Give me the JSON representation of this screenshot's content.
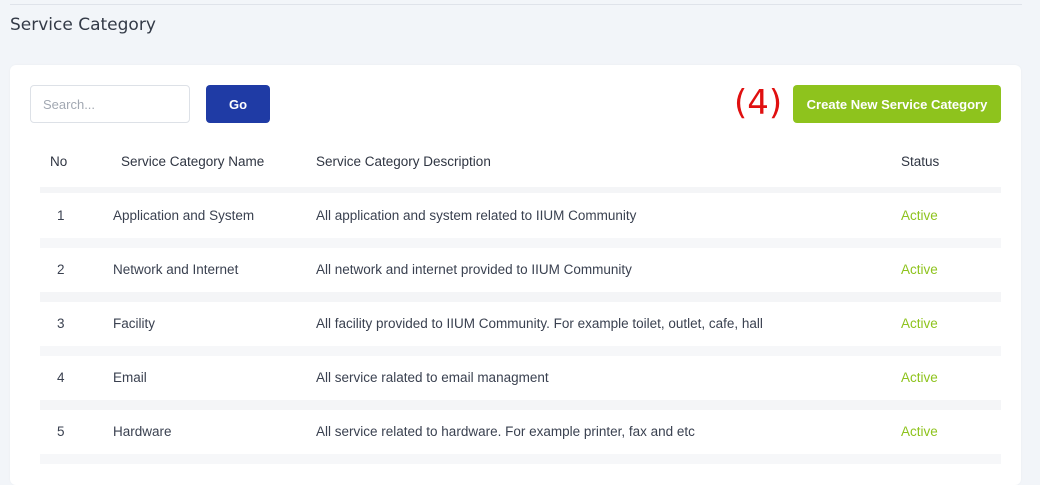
{
  "page": {
    "title": "Service Category"
  },
  "toolbar": {
    "search_placeholder": "Search...",
    "go_label": "Go",
    "annotation": "(4)",
    "create_label": "Create New Service Category"
  },
  "table": {
    "headers": {
      "no": "No",
      "name": "Service Category Name",
      "description": "Service Category Description",
      "status": "Status"
    },
    "rows": [
      {
        "no": "1",
        "name": "Application and System",
        "description": "All application and system related to IIUM Community",
        "status": "Active"
      },
      {
        "no": "2",
        "name": "Network and Internet",
        "description": "All network and internet provided to IIUM Community",
        "status": "Active"
      },
      {
        "no": "3",
        "name": "Facility",
        "description": "All facility provided to IIUM Community. For example toilet, outlet, cafe, hall",
        "status": "Active"
      },
      {
        "no": "4",
        "name": "Email",
        "description": "All service ralated to email managment",
        "status": "Active"
      },
      {
        "no": "5",
        "name": "Hardware",
        "description": "All service related to hardware. For example printer, fax and etc",
        "status": "Active"
      }
    ]
  },
  "colors": {
    "primary": "#1f3ba5",
    "accent": "#8ec31d",
    "annotation": "#e01010"
  }
}
